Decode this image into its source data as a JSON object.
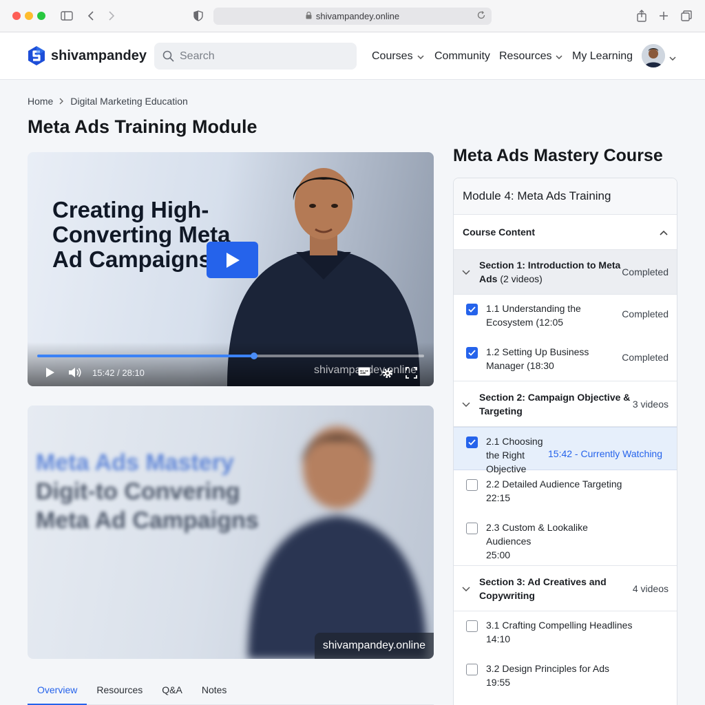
{
  "browser": {
    "url": "shivampandey.online"
  },
  "header": {
    "logo_text": "shivampandey",
    "search_placeholder": "Search",
    "nav": [
      {
        "label": "Courses"
      },
      {
        "label": "Community"
      },
      {
        "label": "Resources"
      },
      {
        "label": "My Learning"
      }
    ]
  },
  "breadcrumb": {
    "home": "Home",
    "current": "Digital Marketing Education"
  },
  "page_title": "Meta Ads Training Module",
  "player": {
    "title": "Creating High-Converting Meta Ad Campaigns",
    "current_time": "15:42 / 28:10",
    "progress": 0.56,
    "watermark": "shivampandey.online"
  },
  "player2": {
    "line1": "Meta Ads Mastery",
    "line2": "Digit-to Convering",
    "line3": "Meta Ad Campaigns",
    "watermark": "shivampandey.online"
  },
  "tabs": [
    "Overview",
    "Resources",
    "Q&A",
    "Notes"
  ],
  "sidebar": {
    "course_title": "Meta Ads Mastery Course",
    "module_title": "Module 4: Meta Ads Training",
    "content_label": "Course Content",
    "sections": [
      {
        "title": "Section 1: Introduction to Meta Ads",
        "count": "(2 videos)",
        "meta": "Completed",
        "lessons": [
          {
            "label": "1.1 Understanding the Ecosystem (12:05",
            "status": "Completed",
            "checked": true
          },
          {
            "label": "1.2 Setting Up Business Manager (18:30",
            "status": "Completed",
            "checked": true
          }
        ]
      },
      {
        "title": "Section 2: Campaign Objective & Targeting",
        "meta": "3 videos",
        "lessons": [
          {
            "label": "2.1 Choosing the Right Objective",
            "status": "15:42 - Currently Watching",
            "checked": true
          },
          {
            "label": "2.2 Detailed Audience Targeting",
            "duration": "22:15",
            "checked": false
          },
          {
            "label": "2.3 Custom & Lookalike Audiences",
            "duration": "25:00",
            "checked": false
          }
        ]
      },
      {
        "title": "Section 3: Ad Creatives and Copywriting",
        "meta": "4 videos",
        "lessons": [
          {
            "label": "3.1 Crafting Compelling Headlines",
            "duration": "14:10",
            "checked": false
          },
          {
            "label": "3.2 Design Principles for Ads",
            "duration": "19:55",
            "checked": false
          }
        ]
      }
    ]
  }
}
